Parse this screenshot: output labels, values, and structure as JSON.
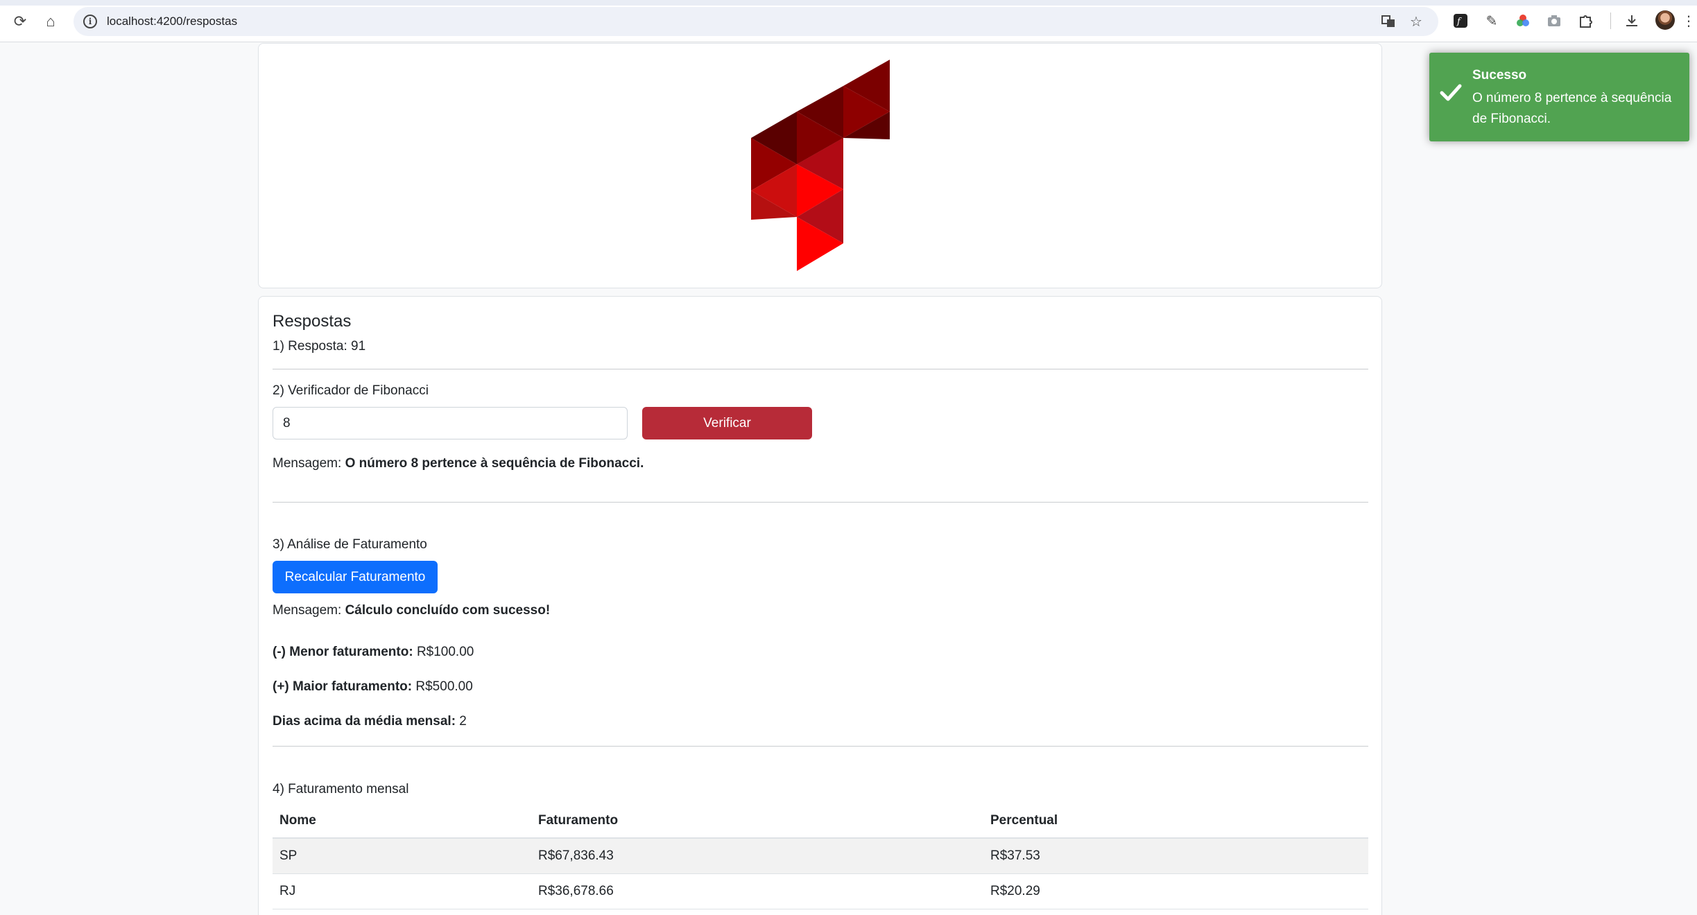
{
  "browser": {
    "url": "localhost:4200/respostas"
  },
  "respostas": {
    "title": "Respostas",
    "q1": {
      "label": "1) Resposta:",
      "value": "91"
    },
    "q2": {
      "label": "2) Verificador de Fibonacci",
      "input_value": "8",
      "button_label": "Verificar",
      "message_label": "Mensagem:",
      "message_value": "O número 8 pertence à sequência de Fibonacci."
    },
    "q3": {
      "label": "3) Análise de Faturamento",
      "button_label": "Recalcular Faturamento",
      "message_label": "Mensagem:",
      "message_value": "Cálculo concluído com sucesso!",
      "menor_label": "(-) Menor faturamento:",
      "menor_value": "R$100.00",
      "maior_label": "(+) Maior faturamento:",
      "maior_value": "R$500.00",
      "dias_label": "Dias acima da média mensal:",
      "dias_value": "2"
    },
    "q4": {
      "label": "4) Faturamento mensal",
      "columns": [
        "Nome",
        "Faturamento",
        "Percentual"
      ],
      "rows": [
        [
          "SP",
          "R$67,836.43",
          "R$37.53"
        ],
        [
          "RJ",
          "R$36,678.66",
          "R$20.29"
        ]
      ]
    }
  },
  "toast": {
    "title": "Sucesso",
    "message": "O número 8 pertence à sequência de Fibonacci."
  },
  "colors": {
    "verify_button": "#b72b38",
    "recalc_button": "#0d6efd",
    "toast_bg": "#51a351"
  }
}
